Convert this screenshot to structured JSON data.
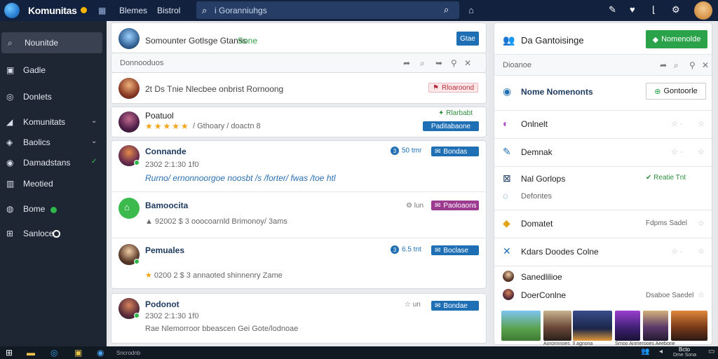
{
  "app": {
    "title": "Komunitas"
  },
  "topbar": {
    "nav": [
      "Blemes",
      "Bistrol"
    ],
    "search_placeholder": "i Goranniuhgs"
  },
  "sidebar": {
    "items": [
      {
        "label": "Nounitde",
        "icon": "search-icon",
        "active": true
      },
      {
        "label": "Gadle",
        "icon": "grid-icon"
      },
      {
        "label": "Donlets",
        "icon": "circle-icon"
      },
      {
        "label": "Komunitats",
        "icon": "megaphone-icon",
        "chevron": "v"
      },
      {
        "label": "Baolics",
        "icon": "tag-icon",
        "chevron": "v"
      },
      {
        "label": "Damadstans",
        "icon": "eye-icon",
        "chevron": "✓"
      },
      {
        "label": "Meotied",
        "icon": "chart-icon"
      },
      {
        "label": "Bome",
        "icon": "clock-icon"
      },
      {
        "label": "Sanloce",
        "icon": "windows-icon"
      }
    ]
  },
  "feed": {
    "composer": {
      "text": "Somounter Gotlsge Gtanss",
      "tag": "Sone",
      "button": "Gtae"
    },
    "section_label": "Donnooduos",
    "notice": {
      "text": "2t Ds Tnie  Nlecbee onbrist Rornoong",
      "button": "Rloaroond"
    },
    "posts": [
      {
        "name": "Poatuol",
        "subtitle": "/ Gthoary / doactn 8",
        "tag": "Rlarbabt",
        "button": "Paditabaone",
        "stars": "★★★★★"
      },
      {
        "name": "Connande",
        "time": "2302 2:1:30 1f0",
        "body": "Rurno/ ernonnoorgoe noosbt /s /forter/ fwas /toe htl",
        "count": "50 tmr",
        "button": "Bondas"
      },
      {
        "name": "Bamoocita",
        "meta": "92002 $ 3 ooocoarnld Brimonoy/ 3ams",
        "count": "lun",
        "button": "Paoloaons"
      },
      {
        "name": "Pemuales",
        "meta": "0200 2 $ 3  annaoted shinnenry Zame",
        "count": "6.5 tnt",
        "button": "Boclase"
      },
      {
        "name": "Podonot",
        "time": "2302 2:1:30 1f0",
        "body": "Rae Nlemorroor bbeascen Gei Gote/lodnoae",
        "count": "un",
        "button": "Bondae"
      }
    ]
  },
  "rpanel": {
    "header": {
      "title": "Da Gantoisinge",
      "button": "Nomenolde"
    },
    "subheader": "Dioanoe",
    "highlight": {
      "title": "Nome Nomenonts",
      "button": "Gontoorle"
    },
    "rows": [
      {
        "label": "Onlnelt"
      },
      {
        "label": "Demnak"
      },
      {
        "label": "Nal Gorlops",
        "status": "Reatie Tnt",
        "sub": "Defontes"
      },
      {
        "label": "Domatet",
        "right": "Fdpms Sadel"
      },
      {
        "label": "Kdars Doodes Colne"
      },
      {
        "label": "Sanedlilioe"
      },
      {
        "label": "DoerConlne",
        "right": "Dsaboe Saedel"
      }
    ],
    "thumb_captions": [
      "Aoronnnoes",
      "ll agnona",
      "Srnoo Anmerooes Aeebone"
    ]
  },
  "taskbar": {
    "items": [
      "Windows",
      "Files",
      "Edge",
      "Store",
      "Browser"
    ],
    "label": "Sncrodnb",
    "clock": "Bcto",
    "date": "Dme Sona"
  },
  "colors": {
    "topbar": "#12213d",
    "sidebar": "#1f2633",
    "accent": "#1f6fb5",
    "green": "#2fb84a",
    "purple": "#9c3a8f"
  }
}
